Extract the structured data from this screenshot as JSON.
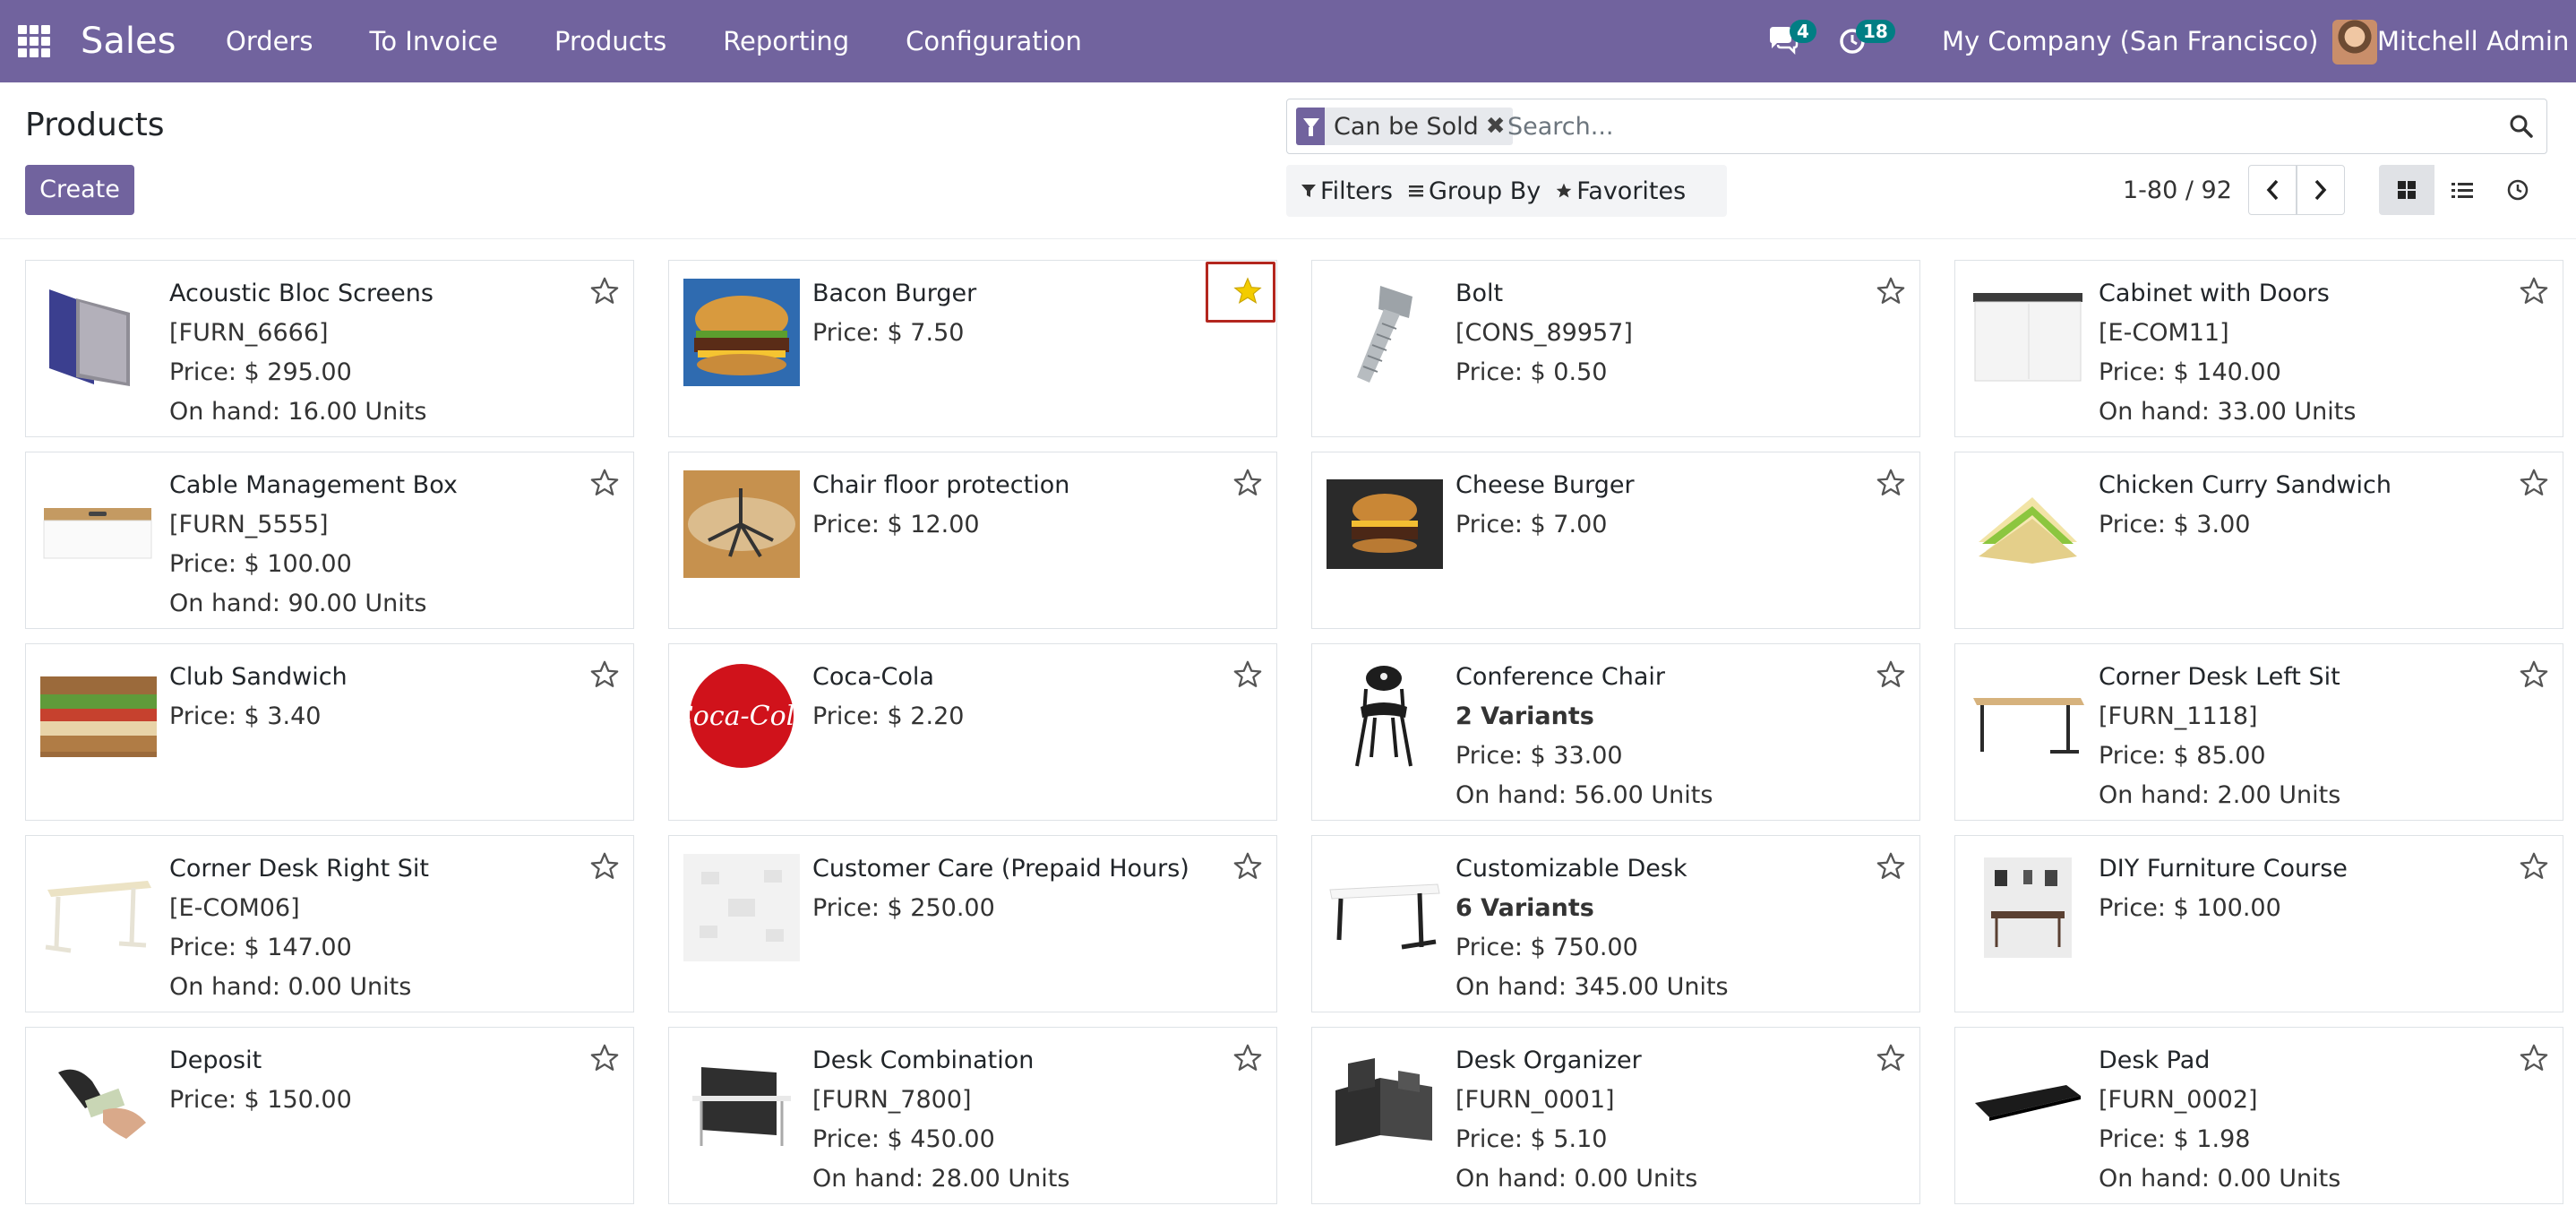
{
  "navbar": {
    "app_name": "Sales",
    "menu": [
      "Orders",
      "To Invoice",
      "Products",
      "Reporting",
      "Configuration"
    ],
    "messages_count": "4",
    "activities_count": "18",
    "company": "My Company (San Francisco)",
    "user": "Mitchell Admin"
  },
  "control": {
    "title": "Products",
    "create_label": "Create",
    "facet_label": "Can be Sold",
    "search_placeholder": "Search...",
    "filters_label": "Filters",
    "groupby_label": "Group By",
    "favorites_label": "Favorites",
    "pager": "1-80 / 92"
  },
  "products": [
    {
      "name": "Acoustic Bloc Screens",
      "lines": [
        "[FURN_6666]",
        "Price: $ 295.00",
        "On hand: 16.00 Units"
      ],
      "favorite": false
    },
    {
      "name": "Bacon Burger",
      "lines": [
        "Price: $ 7.50"
      ],
      "favorite": true
    },
    {
      "name": "Bolt",
      "lines": [
        "[CONS_89957]",
        "Price: $ 0.50"
      ],
      "favorite": false
    },
    {
      "name": "Cabinet with Doors",
      "lines": [
        "[E-COM11]",
        "Price: $ 140.00",
        "On hand: 33.00 Units"
      ],
      "favorite": false
    },
    {
      "name": "Cable Management Box",
      "lines": [
        "[FURN_5555]",
        "Price: $ 100.00",
        "On hand: 90.00 Units"
      ],
      "favorite": false
    },
    {
      "name": "Chair floor protection",
      "lines": [
        "Price: $ 12.00"
      ],
      "favorite": false
    },
    {
      "name": "Cheese Burger",
      "lines": [
        "Price: $ 7.00"
      ],
      "favorite": false
    },
    {
      "name": "Chicken Curry Sandwich",
      "lines": [
        "Price: $ 3.00"
      ],
      "favorite": false
    },
    {
      "name": "Club Sandwich",
      "lines": [
        "Price: $ 3.40"
      ],
      "favorite": false
    },
    {
      "name": "Coca-Cola",
      "lines": [
        "Price: $ 2.20"
      ],
      "favorite": false
    },
    {
      "name": "Conference Chair",
      "lines": [
        "2 Variants",
        "Price: $ 33.00",
        "On hand: 56.00 Units"
      ],
      "favorite": false
    },
    {
      "name": "Corner Desk Left Sit",
      "lines": [
        "[FURN_1118]",
        "Price: $ 85.00",
        "On hand: 2.00 Units"
      ],
      "favorite": false
    },
    {
      "name": "Corner Desk Right Sit",
      "lines": [
        "[E-COM06]",
        "Price: $ 147.00",
        "On hand: 0.00 Units"
      ],
      "favorite": false
    },
    {
      "name": "Customer Care (Prepaid Hours)",
      "lines": [
        "Price: $ 250.00"
      ],
      "favorite": false
    },
    {
      "name": "Customizable Desk",
      "lines": [
        "6 Variants",
        "Price: $ 750.00",
        "On hand: 345.00 Units"
      ],
      "favorite": false
    },
    {
      "name": "DIY Furniture Course",
      "lines": [
        "Price: $ 100.00"
      ],
      "favorite": false
    },
    {
      "name": "Deposit",
      "lines": [
        "Price: $ 150.00"
      ],
      "favorite": false
    },
    {
      "name": "Desk Combination",
      "lines": [
        "[FURN_7800]",
        "Price: $ 450.00",
        "On hand: 28.00 Units"
      ],
      "favorite": false
    },
    {
      "name": "Desk Organizer",
      "lines": [
        "[FURN_0001]",
        "Price: $ 5.10",
        "On hand: 0.00 Units"
      ],
      "favorite": false
    },
    {
      "name": "Desk Pad",
      "lines": [
        "[FURN_0002]",
        "Price: $ 1.98",
        "On hand: 0.00 Units"
      ],
      "favorite": false
    }
  ],
  "colors": {
    "brand": "#71639e",
    "badge": "#017e84",
    "favorite_star": "#f3cc00",
    "highlight_box": "#b3261e"
  }
}
